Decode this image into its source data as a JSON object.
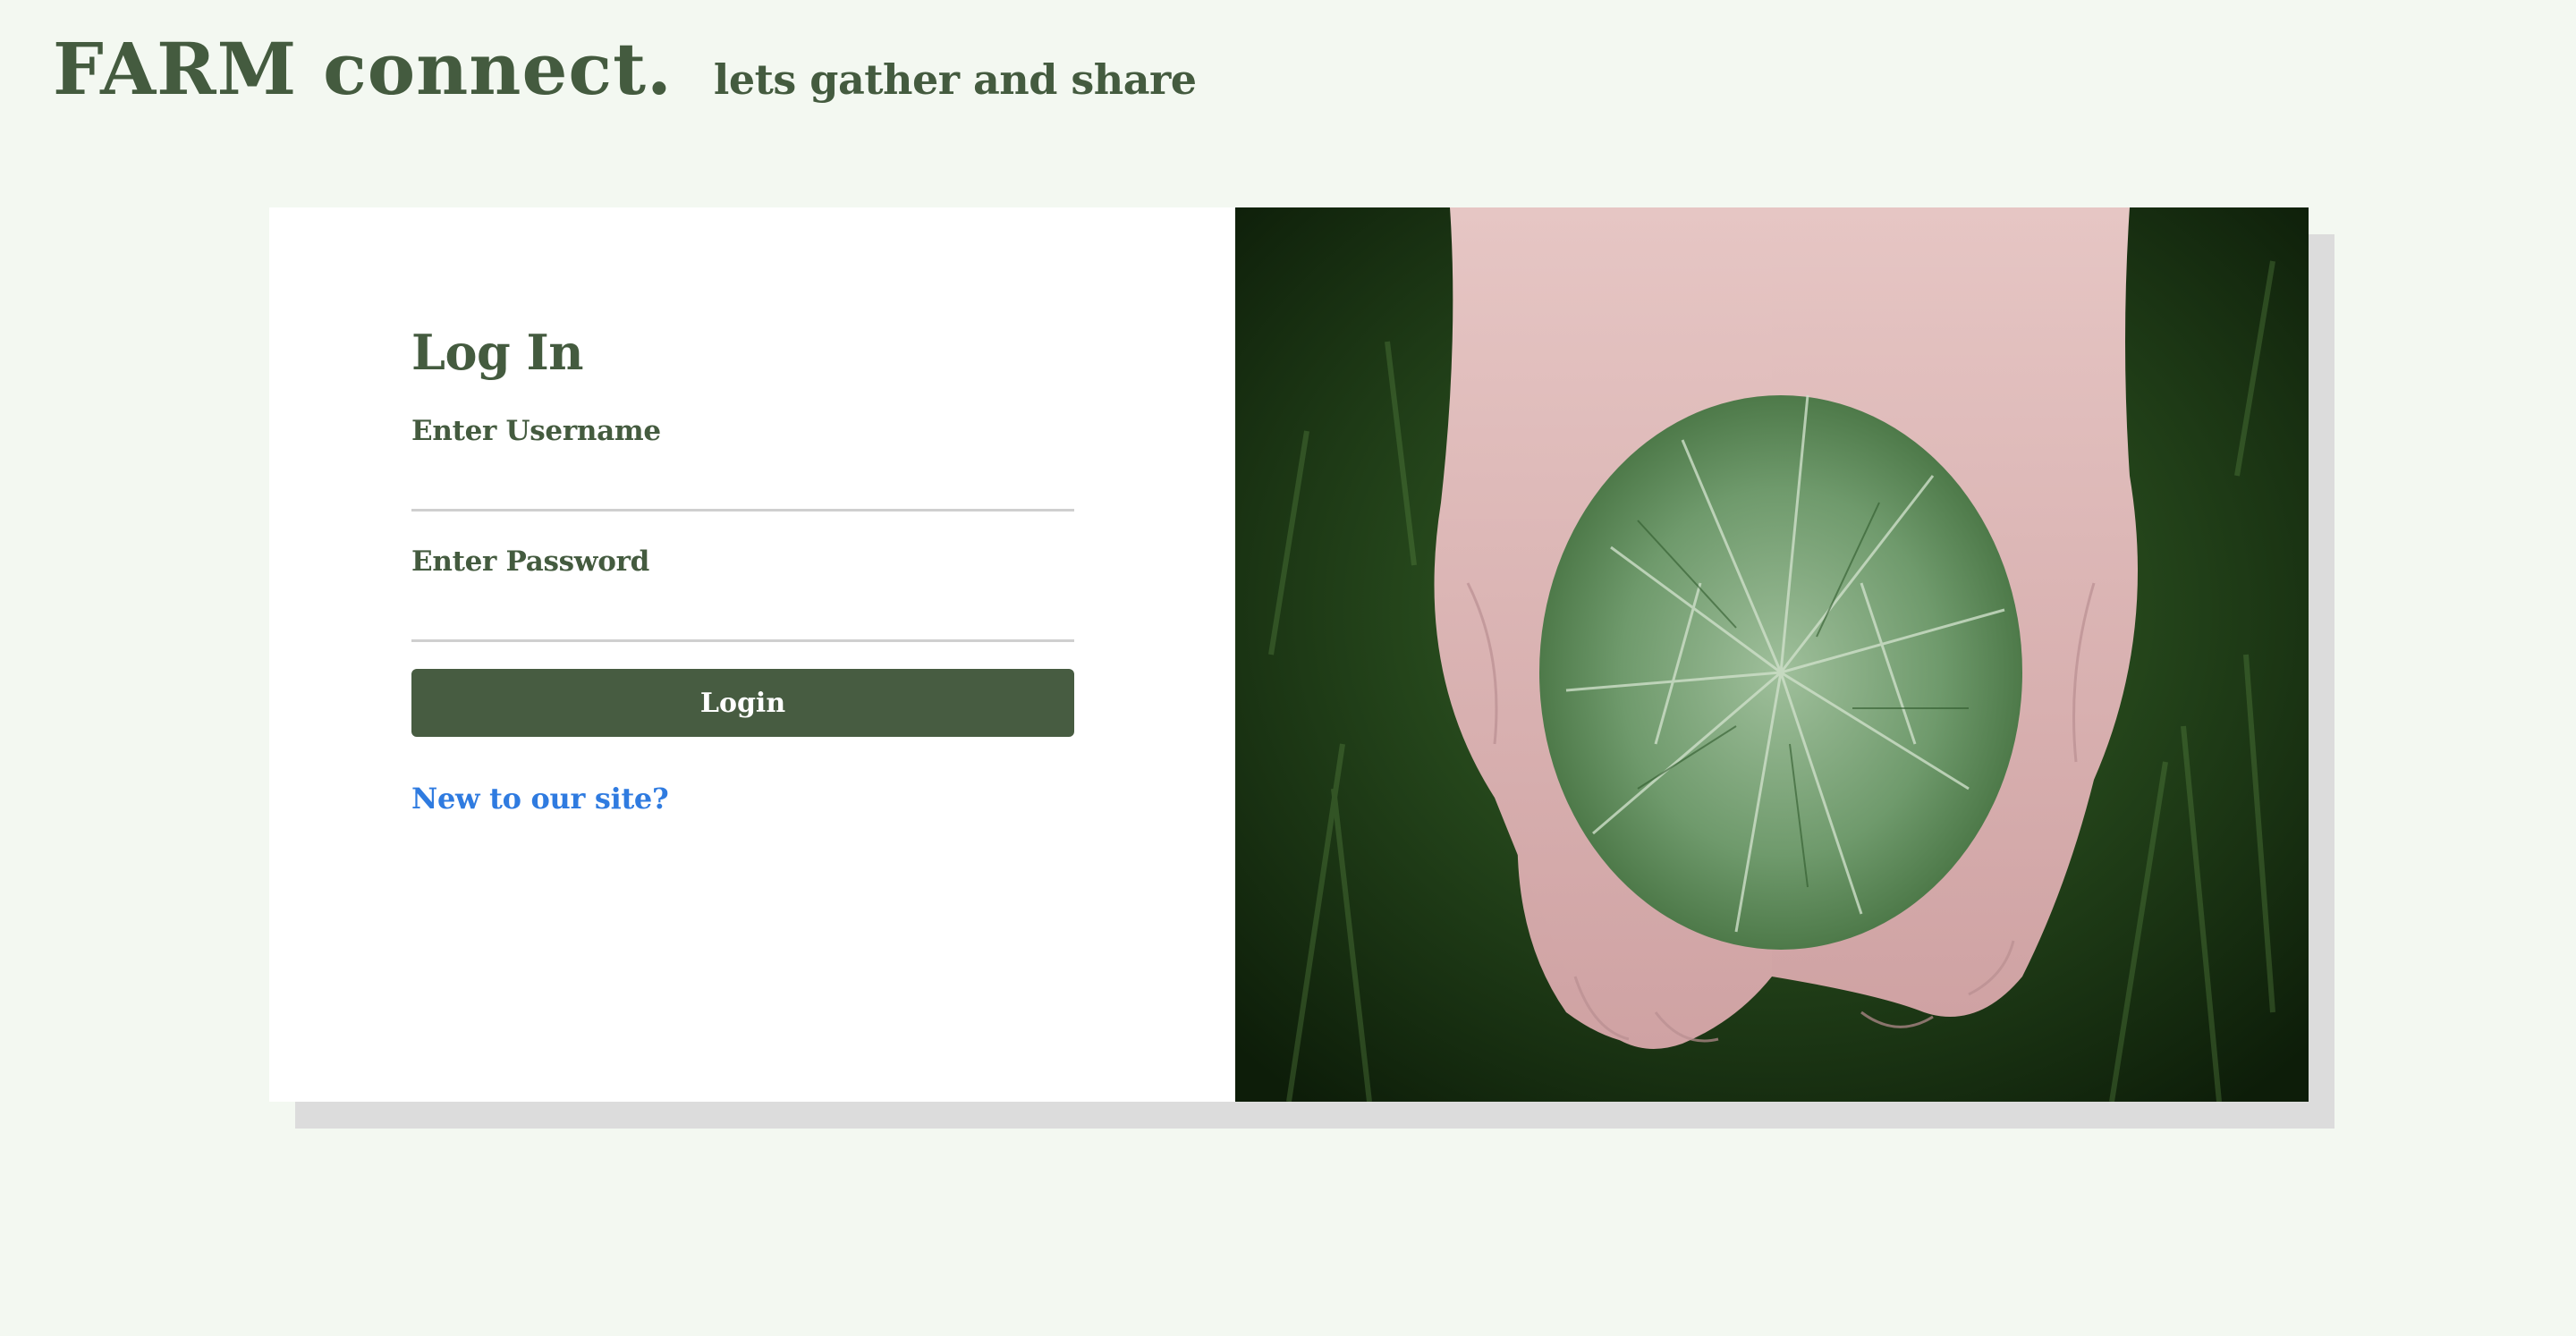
{
  "brand": {
    "title": "FARM connect.",
    "tagline": "lets gather and share"
  },
  "login": {
    "heading": "Log In",
    "username_label": "Enter Username",
    "username_value": "",
    "password_label": "Enter Password",
    "password_value": "",
    "button_label": "Login",
    "signup_link": "New to our site?"
  },
  "photo": {
    "subject": "hands-holding-pine-needles"
  },
  "colors": {
    "background": "#f3f8f1",
    "brand_green": "#445b3f",
    "button_green": "#475c41",
    "link_blue": "#2f7be0",
    "card_shadow": "#dcdcdc"
  }
}
